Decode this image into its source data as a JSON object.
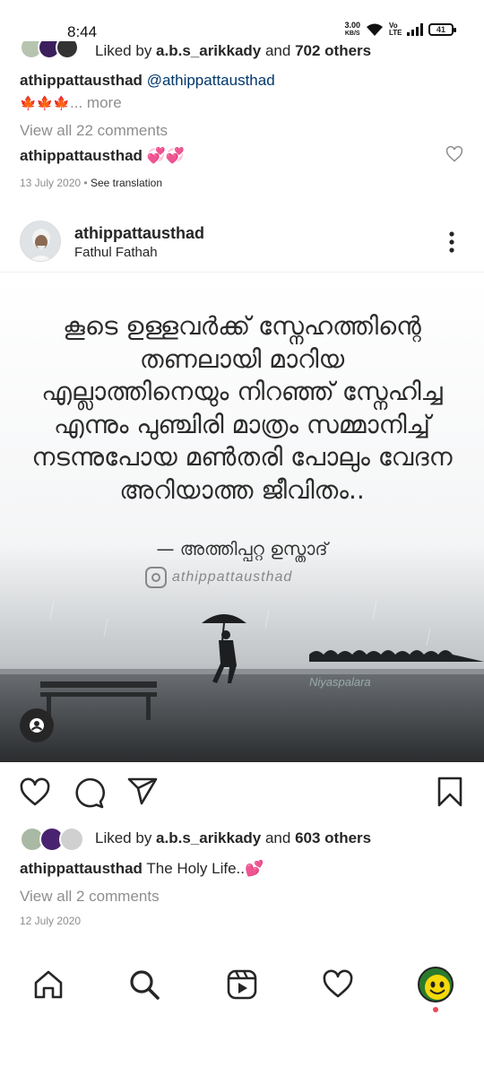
{
  "status_bar": {
    "time": "8:44",
    "net_speed": "3.00",
    "net_unit": "KB/S",
    "volte": "Vo LTE",
    "battery": "41"
  },
  "previous_post": {
    "liked_by_prefix": "Liked by ",
    "liked_by_user": "a.b.s_arikkady",
    "liked_by_suffix": " and ",
    "liked_by_count": "702 others",
    "caption_user": "athippattausthad",
    "caption_mention": "@athippattausthad",
    "caption_emoji": "🍁🍁🍁",
    "more_label": "... more",
    "view_comments": "View all 22 comments",
    "comment_user": "athippattausthad",
    "comment_text": "💞💞",
    "date": "13 July 2020",
    "see_translation": "See translation"
  },
  "post": {
    "username": "athippattausthad",
    "location": "Fathul Fathah",
    "image": {
      "quote_lines": [
        "കൂടെ ഉള്ളവർക്ക് സ്നേഹത്തിന്റെ",
        "തണലായി മാറിയ",
        "എല്ലാത്തിനെയും നിറഞ്ഞ് സ്നേഹിച്ച",
        "എന്നും പുഞ്ചിരി മാത്രം സമ്മാനിച്ച്",
        "നടന്നുപോയ മൺതരി പോലും വേദന",
        "അറിയാത്ത ജീവിതം.."
      ],
      "author": "— അത്തിപ്പറ്റ ഉസ്താദ്",
      "handle": "athippattausthad",
      "watermark": "Niyaspalara"
    },
    "liked_by_prefix": "Liked by ",
    "liked_by_user": "a.b.s_arikkady",
    "liked_by_suffix": " and ",
    "liked_by_count": "603 others",
    "caption_user": "athippattausthad",
    "caption_text": " The Holy Life..💕",
    "view_comments": "View all 2 comments",
    "date": "12 July 2020"
  },
  "icons": {
    "like": "heart-icon",
    "comment": "comment-icon",
    "share": "send-icon",
    "save": "bookmark-icon",
    "more": "more-vertical-icon",
    "tag": "person-tag-icon",
    "nav": [
      "home-icon",
      "search-icon",
      "reels-icon",
      "activity-heart-icon",
      "profile-avatar"
    ]
  },
  "colors": {
    "text": "#262626",
    "muted": "#8e8e8e",
    "mention": "#00376b",
    "notification": "#ed4956"
  }
}
